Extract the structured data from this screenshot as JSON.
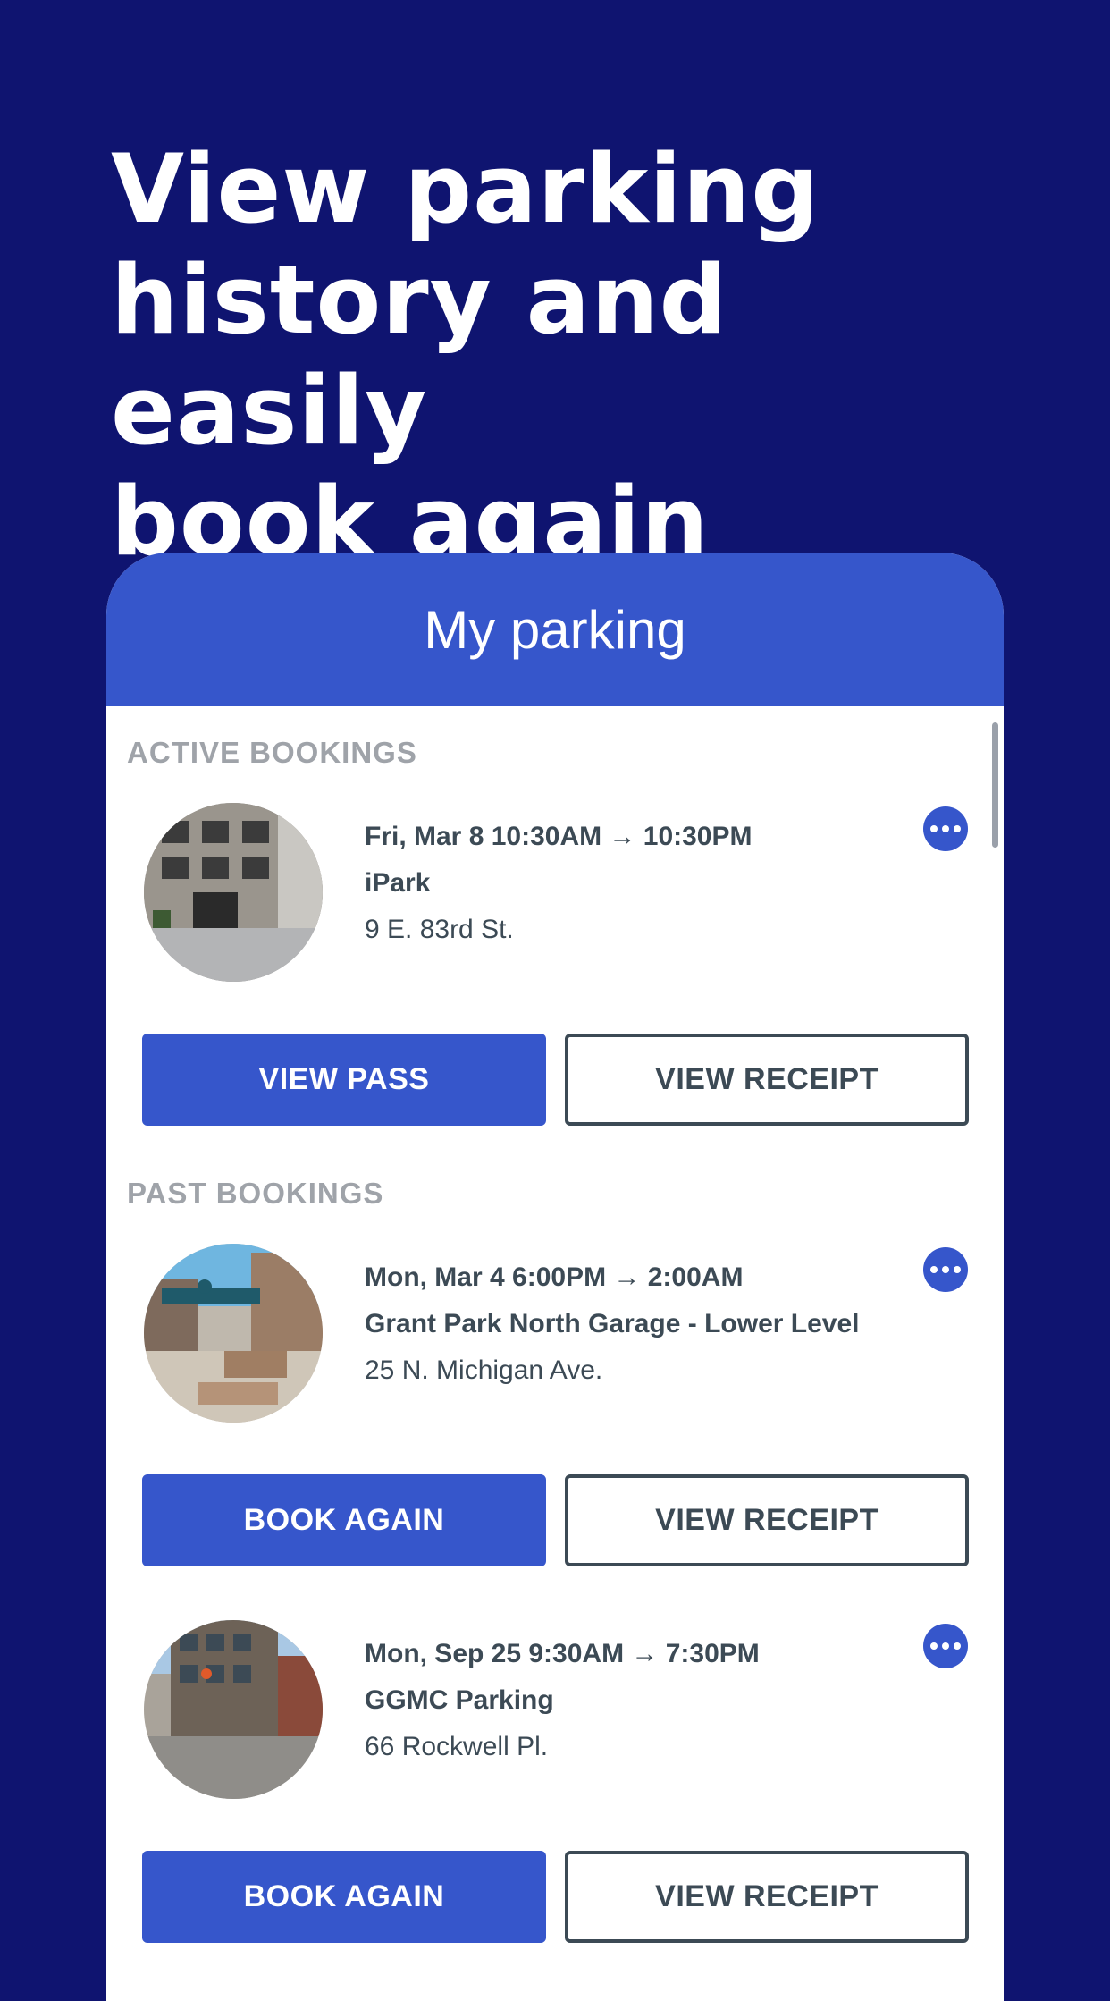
{
  "headline": [
    "View parking",
    "history and easily",
    "book again"
  ],
  "screen": {
    "title": "My parking"
  },
  "sections": {
    "active": "ACTIVE BOOKINGS",
    "past": "PAST BOOKINGS"
  },
  "bookings": [
    {
      "datetime": "Fri, Mar 8 10:30AM → 10:30PM",
      "name": "iPark",
      "address": "9 E. 83rd St.",
      "primary_label": "VIEW PASS",
      "secondary_label": "VIEW RECEIPT"
    },
    {
      "datetime": "Mon, Mar 4 6:00PM → 2:00AM",
      "name": "Grant Park North Garage - Lower Level",
      "address": "25 N. Michigan Ave.",
      "primary_label": "BOOK AGAIN",
      "secondary_label": "VIEW RECEIPT"
    },
    {
      "datetime": "Mon, Sep 25 9:30AM → 7:30PM",
      "name": "GGMC Parking",
      "address": "66 Rockwell Pl.",
      "primary_label": "BOOK AGAIN",
      "secondary_label": "VIEW RECEIPT"
    }
  ],
  "colors": {
    "background": "#0f1470",
    "accent": "#3656cb",
    "text": "#3c4a55",
    "muted": "#9fa3a9"
  },
  "icons": {
    "more": "more-horizontal-icon"
  }
}
